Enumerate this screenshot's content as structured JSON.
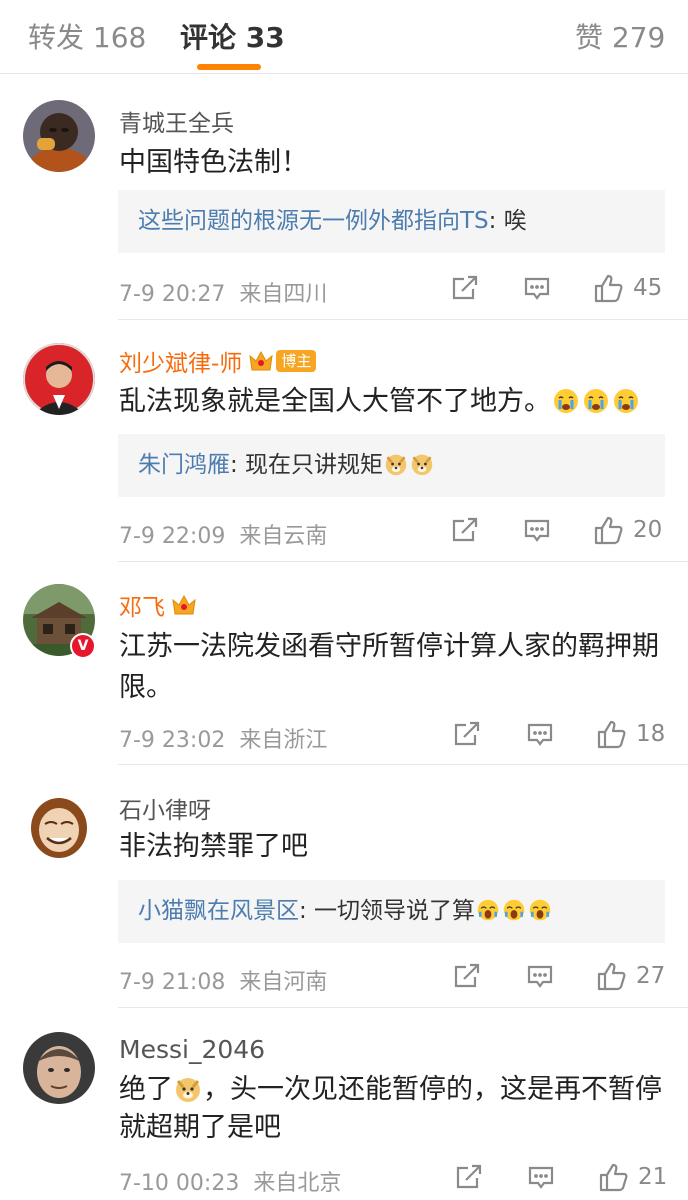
{
  "tabs": {
    "repost": "转发 168",
    "comments": "评论 33",
    "likes": "赞 279"
  },
  "accent_color": "#ff8200",
  "link_color": "#4d7dae",
  "comments": [
    {
      "username": "青城王全兵",
      "text": "中国特色法制！",
      "reply": {
        "name": "这些问题的根源无一例外都指向TS",
        "text": ": 唉"
      },
      "time": "7-9 20:27",
      "location": "来自四川",
      "likes": "45"
    },
    {
      "username": "刘少斌律-师",
      "badge": "博主",
      "text": "乱法现象就是全国人大管不了地方。",
      "reply": {
        "name": "朱门鸿雁",
        "text": ": 现在只讲规矩"
      },
      "time": "7-9 22:09",
      "location": "来自云南",
      "likes": "20"
    },
    {
      "username": "邓飞",
      "verified": "V",
      "text": "江苏一法院发函看守所暂停计算人家的羁押期限。",
      "time": "7-9 23:02",
      "location": "来自浙江",
      "likes": "18"
    },
    {
      "username": "石小律呀",
      "text": "非法拘禁罪了吧",
      "reply": {
        "name": "小猫飘在风景区",
        "text": ": 一切领导说了算"
      },
      "time": "7-9 21:08",
      "location": "来自河南",
      "likes": "27"
    },
    {
      "username": "Messi_2046",
      "text_before_emoji": "绝了",
      "text_after_emoji": "，头一次见还能暂停的，这是再不暂停就超期了是吧",
      "time": "7-10 00:23",
      "location": "来自北京",
      "likes": "21"
    }
  ]
}
